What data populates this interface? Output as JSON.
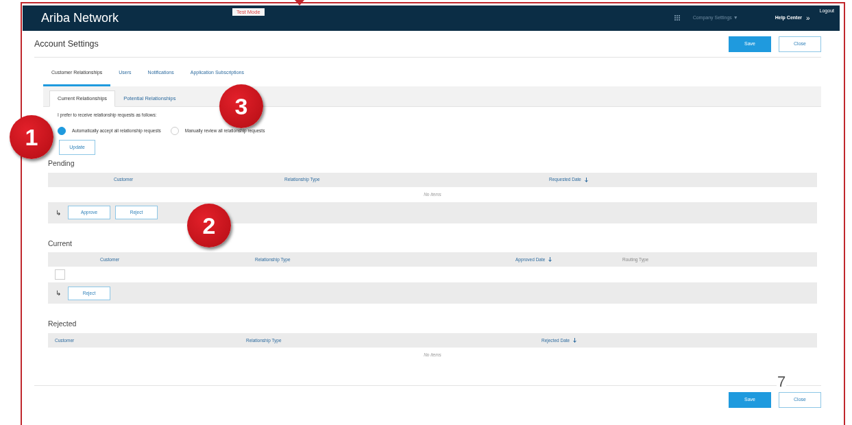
{
  "header": {
    "logo": "Ariba Network",
    "mode_badge": "Test Mode",
    "menu": "Company Settings ▼",
    "help": "Help Center",
    "expand": "»",
    "logout": "Logout"
  },
  "page_title": "Account Settings",
  "top_buttons": [
    {
      "label": "Save",
      "kind": "primary"
    },
    {
      "label": "Close",
      "kind": "secondary"
    }
  ],
  "tabs": [
    {
      "label": "Customer Relationships",
      "selected": true
    },
    {
      "label": "Users",
      "selected": false
    },
    {
      "label": "Notifications",
      "selected": false
    },
    {
      "label": "Application Subscriptions",
      "selected": false
    }
  ],
  "subtabs": [
    {
      "label": "Current Relationships",
      "selected": true
    },
    {
      "label": "Potential Relationships",
      "selected": false
    }
  ],
  "preference": {
    "prompt": "I prefer to receive relationship requests as follows:",
    "options": [
      {
        "label": "Automatically accept all relationship requests",
        "selected": true
      },
      {
        "label": "Manually review all relationship requests",
        "selected": false
      }
    ],
    "button": "Update"
  },
  "sections": [
    {
      "title": "Pending",
      "columns": [
        {
          "label": "Customer",
          "sort": false,
          "link": true
        },
        {
          "label": "Relationship Type",
          "sort": false,
          "link": true
        },
        {
          "label": "Requested Date",
          "sort": true,
          "link": true
        }
      ],
      "empty_text": "No items",
      "action_marker": "↳",
      "actions": [
        "Approve",
        "Reject"
      ]
    },
    {
      "title": "Current",
      "columns": [
        {
          "label": "Customer",
          "sort": false,
          "link": true
        },
        {
          "label": "Relationship Type",
          "sort": false,
          "link": true
        },
        {
          "label": "Approved Date",
          "sort": true,
          "link": true
        },
        {
          "label": "Routing Type",
          "sort": false,
          "link": false
        }
      ],
      "rows": [
        {
          "checked": false
        }
      ],
      "action_marker": "↳",
      "actions": [
        "Reject"
      ]
    },
    {
      "title": "Rejected",
      "columns": [
        {
          "label": "Customer",
          "sort": false,
          "link": true
        },
        {
          "label": "Relationship Type",
          "sort": false,
          "link": true
        },
        {
          "label": "Rejected Date",
          "sort": true,
          "link": true
        }
      ],
      "empty_text": "No items"
    }
  ],
  "bottom_buttons": [
    {
      "label": "Save",
      "kind": "primary"
    },
    {
      "label": "Close",
      "kind": "secondary"
    }
  ],
  "annotations": [
    {
      "number": "1"
    },
    {
      "number": "2"
    },
    {
      "number": "3"
    }
  ],
  "page_number": "7"
}
